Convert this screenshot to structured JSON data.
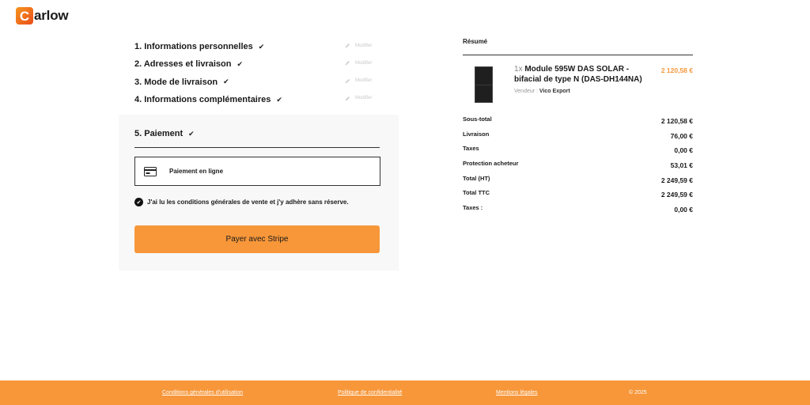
{
  "brand": {
    "logo_letter": "C",
    "logo_rest": "arlow"
  },
  "steps": [
    {
      "title": "1. Informations personnelles",
      "edit": "Modifier"
    },
    {
      "title": "2. Adresses et livraison",
      "edit": "Modifier"
    },
    {
      "title": "3. Mode de livraison",
      "edit": "Modifier"
    },
    {
      "title": "4. Informations complémentaires",
      "edit": "Modifier"
    }
  ],
  "check_glyph": "✔",
  "payment": {
    "title": "5. Paiement",
    "method_label": "Paiement en ligne",
    "terms_label": "J'ai lu les conditions générales de vente et j'y adhère sans réserve.",
    "pay_button": "Payer avec Stripe"
  },
  "summary": {
    "title": "Résumé",
    "product": {
      "qty": "1x",
      "name": "Module 595W DAS SOLAR - bifacial de type N (DAS-DH144NA)",
      "vendor_label": "Vendeur :",
      "vendor_name": "Vico Export",
      "price": "2 120,58 €"
    },
    "totals": [
      {
        "label": "Sous-total",
        "value": "2 120,58 €"
      },
      {
        "label": "Livraison",
        "value": "76,00 €"
      },
      {
        "label": "Taxes",
        "value": "0,00 €"
      },
      {
        "label": "Protection acheteur",
        "value": "53,01 €"
      },
      {
        "label": "Total (HT)",
        "value": "2 249,59 €"
      },
      {
        "label": "Total TTC",
        "value": "2 249,59 €"
      },
      {
        "label": "Taxes :",
        "value": "0,00 €"
      }
    ]
  },
  "footer": {
    "cgu": "Conditions générales d'utilisation",
    "privacy": "Politique de confidentialité",
    "legal": "Mentions légales",
    "copyright": "© 2025"
  },
  "colors": {
    "accent": "#f7973a",
    "text": "#1a1a1a"
  }
}
